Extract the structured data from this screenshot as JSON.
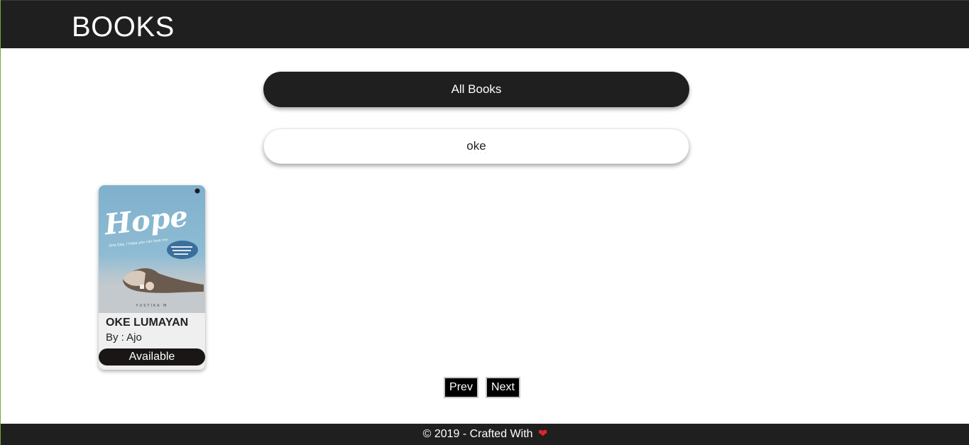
{
  "header": {
    "brand": "BOOKS"
  },
  "filter": {
    "all_books_label": "All Books"
  },
  "search": {
    "value": "oke"
  },
  "books": [
    {
      "title": "OKE LUMAYAN",
      "author": "By : Ajo",
      "status": "Available",
      "cover": {
        "title": "Hope",
        "tagline": "One Day, I hope   you can love me",
        "author": "YUSTIKA M"
      }
    }
  ],
  "pagination": {
    "prev_label": "Prev",
    "next_label": "Next"
  },
  "footer": {
    "text": "© 2019 - Crafted With",
    "icon": "heart-icon"
  },
  "colors": {
    "header_bg": "#1f1f1f",
    "button_bg": "#1f1f1f",
    "status_bg": "#1a1616",
    "heart": "#e0262a"
  }
}
